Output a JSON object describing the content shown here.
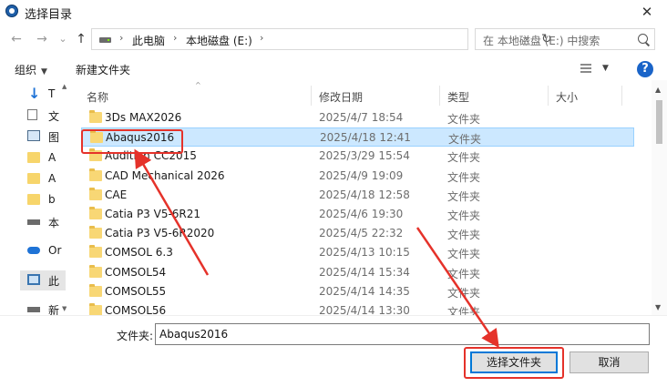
{
  "window": {
    "title": "选择目录",
    "close_glyph": "✕"
  },
  "nav": {
    "back": "←",
    "forward": "→",
    "recent": "⌄",
    "up": "↑",
    "breadcrumbs": [
      "此电脑",
      "本地磁盘 (E:)"
    ],
    "separator": "›",
    "dropdown": "⌄",
    "refresh": "↻",
    "search_placeholder": "在 本地磁盘 (E:) 中搜索"
  },
  "toolbar": {
    "organize": "组织",
    "new_folder": "新建文件夹",
    "help": "?",
    "caret": "▼"
  },
  "sidebar": {
    "items": [
      {
        "label": "T",
        "icon": "download-icon"
      },
      {
        "label": "文",
        "icon": "document-icon"
      },
      {
        "label": "图",
        "icon": "picture-icon"
      },
      {
        "label": "A",
        "icon": "folder-icon"
      },
      {
        "label": "A",
        "icon": "folder-icon"
      },
      {
        "label": "b",
        "icon": "folder-icon"
      },
      {
        "label": "本",
        "icon": "drive-icon"
      },
      {
        "label": "Or",
        "icon": "cloud-icon"
      },
      {
        "label": "此",
        "icon": "computer-icon"
      },
      {
        "label": "新",
        "icon": "drive-icon"
      }
    ]
  },
  "columns": {
    "name": "名称",
    "modified": "修改日期",
    "type": "类型",
    "size": "大小",
    "sort_glyph": "^"
  },
  "files": [
    {
      "name": "3Ds MAX2026",
      "date": "2025/4/7 18:54",
      "type": "文件夹"
    },
    {
      "name": "Abaqus2016",
      "date": "2025/4/18 12:41",
      "type": "文件夹"
    },
    {
      "name": "Audition CC2015",
      "date": "2025/3/29 15:54",
      "type": "文件夹"
    },
    {
      "name": "CAD Mechanical 2026",
      "date": "2025/4/9 19:09",
      "type": "文件夹"
    },
    {
      "name": "CAE",
      "date": "2025/4/18 12:58",
      "type": "文件夹"
    },
    {
      "name": "Catia P3 V5-6R21",
      "date": "2025/4/6 19:30",
      "type": "文件夹"
    },
    {
      "name": "Catia P3 V5-6R2020",
      "date": "2025/4/5 22:32",
      "type": "文件夹"
    },
    {
      "name": "COMSOL 6.3",
      "date": "2025/4/13 10:15",
      "type": "文件夹"
    },
    {
      "name": "COMSOL54",
      "date": "2025/4/14 15:34",
      "type": "文件夹"
    },
    {
      "name": "COMSOL55",
      "date": "2025/4/14 14:35",
      "type": "文件夹"
    },
    {
      "name": "COMSOL56",
      "date": "2025/4/14 13:30",
      "type": "文件夹"
    }
  ],
  "footer": {
    "folder_label": "文件夹:",
    "folder_value": "Abaqus2016",
    "select_button": "选择文件夹",
    "cancel_button": "取消"
  },
  "colors": {
    "annotation": "#e5322a",
    "selection": "#cce8ff",
    "accent": "#0078d7"
  }
}
